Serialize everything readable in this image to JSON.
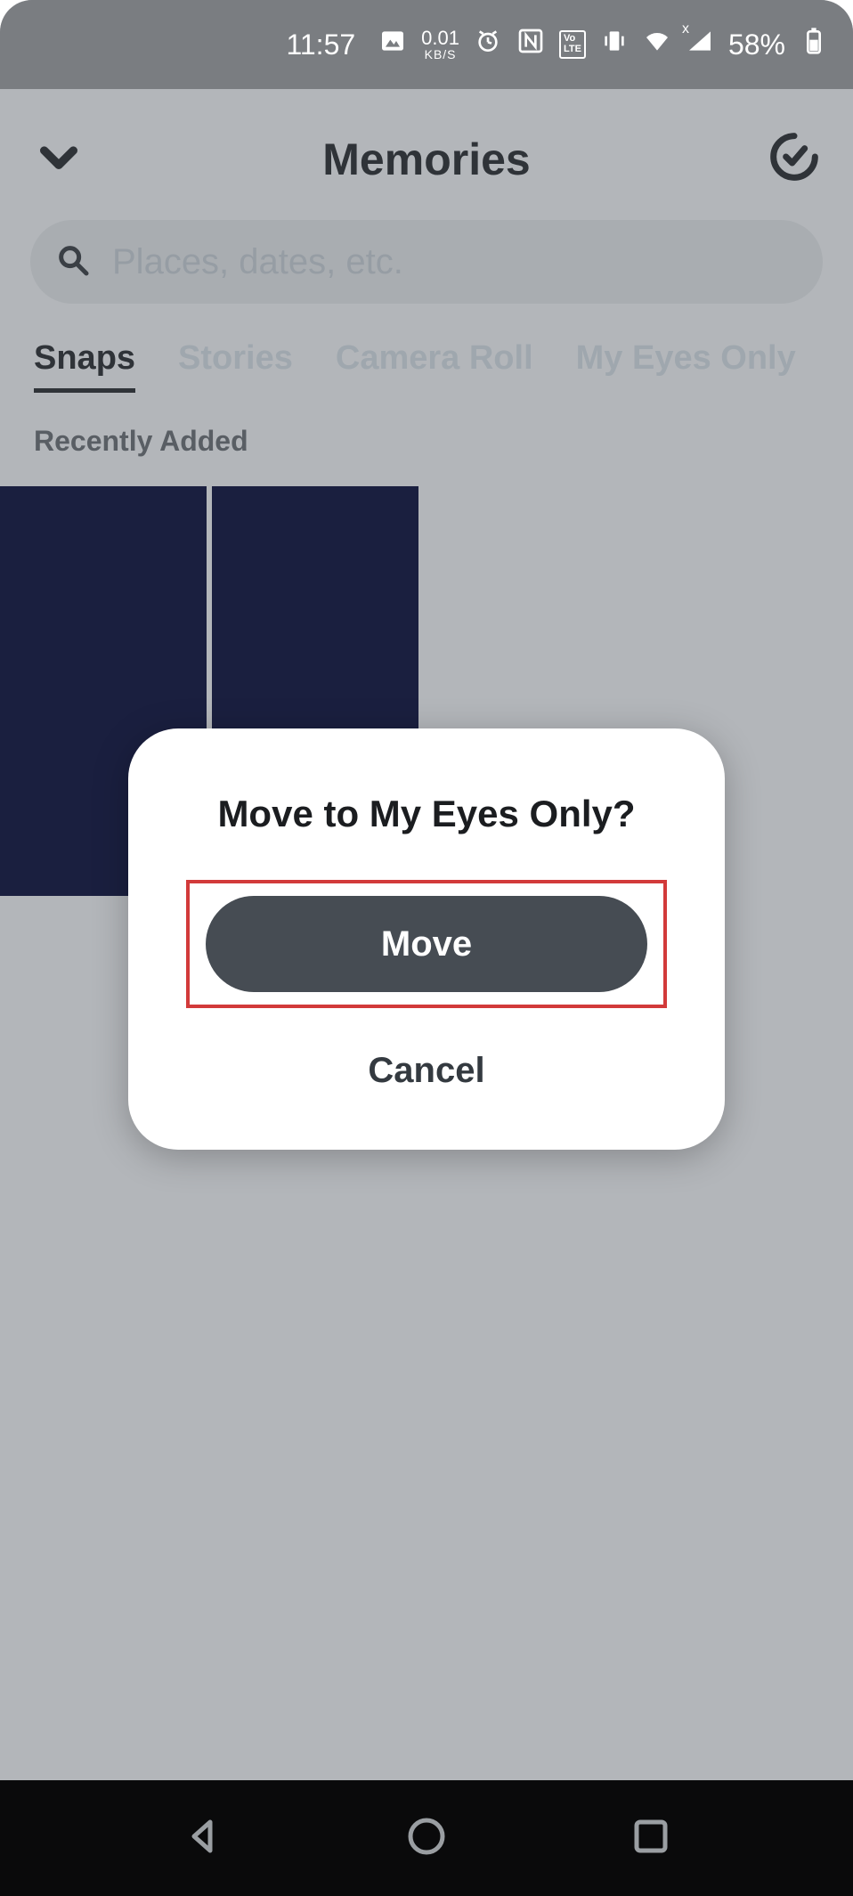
{
  "status": {
    "time": "11:57",
    "data_rate_value": "0.01",
    "data_rate_unit": "KB/S",
    "volte_label": "Vo LTE",
    "battery_percent": "58%"
  },
  "header": {
    "title": "Memories"
  },
  "search": {
    "placeholder": "Places, dates, etc."
  },
  "tabs": [
    {
      "label": "Snaps",
      "active": true
    },
    {
      "label": "Stories",
      "active": false
    },
    {
      "label": "Camera Roll",
      "active": false
    },
    {
      "label": "My Eyes Only",
      "active": false
    }
  ],
  "section_label": "Recently Added",
  "dialog": {
    "title": "Move to My Eyes Only?",
    "move_label": "Move",
    "cancel_label": "Cancel"
  }
}
